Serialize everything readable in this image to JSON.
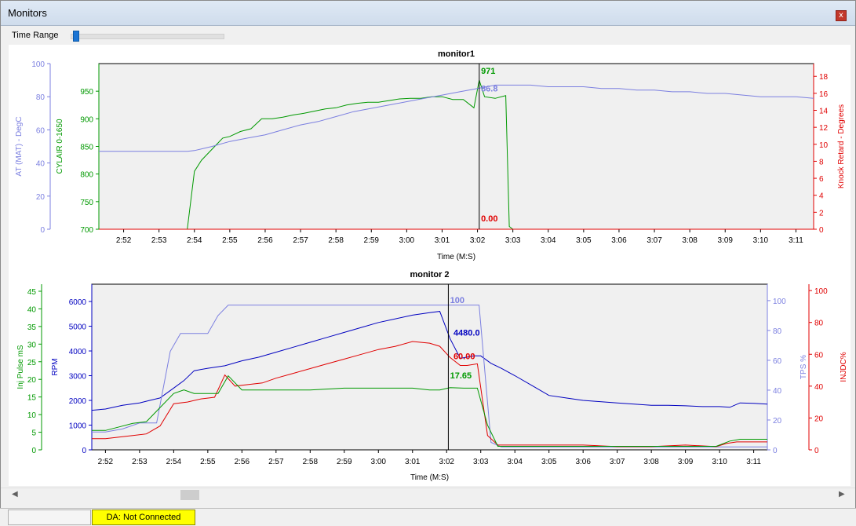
{
  "window": {
    "title": "Monitors",
    "close_label": "x"
  },
  "toolbar": {
    "time_range_label": "Time Range",
    "time_range_value": 0.02
  },
  "status": {
    "pane1": "",
    "da_status": "DA: Not Connected"
  },
  "colors": {
    "green": "#009900",
    "lightblue": "#7b7fe0",
    "red": "#e00000",
    "navy": "#0000c0",
    "darkred": "#cc0000"
  },
  "chart_data": [
    {
      "type": "line",
      "title": "monitor1",
      "xlabel": "Time (M:S)",
      "x_ticks": [
        "2:52",
        "2:53",
        "2:54",
        "2:55",
        "2:56",
        "2:57",
        "2:58",
        "2:59",
        "3:00",
        "3:01",
        "3:02",
        "3:03",
        "3:04",
        "3:05",
        "3:06",
        "3:07",
        "3:08",
        "3:09",
        "3:10",
        "3:11"
      ],
      "x_range": [
        171.3,
        191.5
      ],
      "cursor": {
        "x": 182.05
      },
      "axes": {
        "at": {
          "label": "AT (MAT) - DegC",
          "ylim": [
            0,
            100
          ],
          "ticks": [
            0,
            20,
            40,
            60,
            80,
            100
          ],
          "color": "#7b7fe0"
        },
        "cyl": {
          "label": "CYLAIR 0-1650",
          "ylim": [
            700,
            1000
          ],
          "ticks": [
            700,
            750,
            800,
            850,
            900,
            950
          ],
          "color": "#009900"
        },
        "knock": {
          "label": "Knock Retard - Degrees",
          "ylim": [
            0,
            19.5
          ],
          "ticks": [
            0,
            2,
            4,
            6,
            8,
            10,
            12,
            14,
            16,
            18
          ],
          "color": "#e00000"
        }
      },
      "series": [
        {
          "name": "CYLAIR 0-1650",
          "axis": "cyl",
          "color": "#009900",
          "x": [
            173.8,
            174.0,
            174.2,
            174.5,
            174.8,
            175.0,
            175.3,
            175.6,
            175.9,
            176.2,
            176.5,
            176.8,
            177.1,
            177.4,
            177.7,
            178.0,
            178.3,
            178.6,
            178.9,
            179.2,
            179.5,
            179.8,
            180.1,
            180.4,
            180.7,
            181.0,
            181.3,
            181.6,
            181.9,
            182.05,
            182.2,
            182.5,
            182.8,
            182.9,
            183.0
          ],
          "y": [
            700,
            805,
            825,
            845,
            865,
            868,
            877,
            882,
            900,
            900,
            903,
            907,
            910,
            914,
            918,
            920,
            925,
            928,
            930,
            930,
            933,
            936,
            937,
            937,
            940,
            940,
            935,
            935,
            920,
            970,
            940,
            937,
            942,
            705,
            700
          ],
          "label": "971",
          "label_x": 182.1
        },
        {
          "name": "AT (MAT) - DegC",
          "axis": "at",
          "color": "#7b7fe0",
          "x": [
            171.3,
            173.8,
            174.0,
            174.5,
            175.0,
            175.5,
            176.0,
            176.5,
            177.0,
            177.5,
            178.0,
            178.5,
            179.0,
            179.5,
            180.0,
            180.5,
            181.0,
            181.5,
            182.0,
            182.5,
            183.0,
            183.5,
            184.0,
            184.5,
            185.0,
            185.5,
            186.0,
            186.5,
            187.0,
            187.5,
            188.0,
            188.5,
            189.0,
            189.5,
            190.0,
            190.5,
            191.0,
            191.5
          ],
          "y": [
            47,
            47,
            47.5,
            50,
            53,
            55,
            57,
            60,
            63,
            65,
            68,
            71,
            73,
            75,
            77,
            79,
            81,
            83,
            85,
            87,
            87,
            87,
            86,
            86,
            86,
            85,
            85,
            84,
            84,
            83,
            83,
            82,
            82,
            81,
            80,
            80,
            80,
            79
          ],
          "label": "86.8",
          "label_x": 182.1
        },
        {
          "name": "Knock Retard - Degrees",
          "axis": "knock",
          "color": "#e00000",
          "x": [
            171.3,
            191.5
          ],
          "y": [
            0,
            0
          ],
          "label": "0.00",
          "label_x": 182.1
        }
      ]
    },
    {
      "type": "line",
      "title": "monitor 2",
      "xlabel": "Time (M:S)",
      "x_ticks": [
        "2:52",
        "2:53",
        "2:54",
        "2:55",
        "2:56",
        "2:57",
        "2:58",
        "2:59",
        "3:00",
        "3:01",
        "3:02",
        "3:03",
        "3:04",
        "3:05",
        "3:06",
        "3:07",
        "3:08",
        "3:09",
        "3:10",
        "3:11"
      ],
      "x_range": [
        171.6,
        191.4
      ],
      "cursor": {
        "x": 182.05
      },
      "axes": {
        "inj": {
          "label": "Inj Pulse mS",
          "ylim": [
            0,
            47
          ],
          "ticks": [
            0,
            5,
            10,
            15,
            20,
            25,
            30,
            35,
            40,
            45
          ],
          "color": "#009900"
        },
        "rpm": {
          "label": "RPM",
          "ylim": [
            0,
            6700
          ],
          "ticks": [
            0,
            1000,
            2000,
            3000,
            4000,
            5000,
            6000
          ],
          "color": "#0000c0"
        },
        "tps": {
          "label": "TPS %",
          "ylim": [
            0,
            111
          ],
          "ticks": [
            0,
            20,
            40,
            60,
            80,
            100
          ],
          "color": "#7b7fe0"
        },
        "injdc": {
          "label": "INJDC%",
          "ylim": [
            0,
            104
          ],
          "ticks": [
            0,
            20,
            40,
            60,
            80,
            100
          ],
          "color": "#e00000"
        }
      },
      "series": [
        {
          "name": "RPM",
          "axis": "rpm",
          "color": "#0000c0",
          "x": [
            171.6,
            172.0,
            172.5,
            173.0,
            173.3,
            173.6,
            174.0,
            174.3,
            174.6,
            175.0,
            175.5,
            176.0,
            176.5,
            177.0,
            177.5,
            178.0,
            178.5,
            179.0,
            179.5,
            180.0,
            180.5,
            181.0,
            181.5,
            181.8,
            182.1,
            182.4,
            182.6,
            182.8,
            183.0,
            183.3,
            183.6,
            184.0,
            184.5,
            185.0,
            185.5,
            186.0,
            186.5,
            187.0,
            187.5,
            188.0,
            188.5,
            189.0,
            189.5,
            190.0,
            190.3,
            190.6,
            191.0,
            191.4
          ],
          "y": [
            1600,
            1650,
            1800,
            1900,
            2000,
            2100,
            2500,
            2800,
            3200,
            3300,
            3400,
            3600,
            3750,
            3950,
            4150,
            4350,
            4550,
            4750,
            4950,
            5150,
            5300,
            5450,
            5550,
            5600,
            4500,
            3700,
            3750,
            3800,
            3800,
            3500,
            3300,
            3000,
            2600,
            2200,
            2100,
            2000,
            1950,
            1900,
            1850,
            1800,
            1800,
            1780,
            1750,
            1750,
            1720,
            1900,
            1880,
            1850
          ],
          "label": "4480.0",
          "label_x": 182.2
        },
        {
          "name": "TPS %",
          "axis": "tps",
          "color": "#7b7fe0",
          "x": [
            171.6,
            172.0,
            172.5,
            173.0,
            173.5,
            173.9,
            174.2,
            174.5,
            175.0,
            175.3,
            175.6,
            176.0,
            178.0,
            180.0,
            182.0,
            182.95,
            183.3,
            183.6,
            184.0,
            186.0,
            188.0,
            190.0,
            191.4
          ],
          "y": [
            12,
            12,
            14,
            18,
            18,
            66,
            78,
            78,
            78,
            90,
            97,
            97,
            97,
            97,
            97,
            97,
            5,
            2,
            2,
            2,
            2,
            2,
            2
          ],
          "label": "100",
          "label_x": 182.1
        },
        {
          "name": "INJDC%",
          "axis": "injdc",
          "color": "#e00000",
          "x": [
            171.6,
            172.0,
            172.4,
            172.8,
            173.2,
            173.6,
            174.0,
            174.4,
            174.8,
            175.2,
            175.5,
            175.8,
            176.2,
            176.6,
            177.0,
            177.5,
            178.0,
            178.5,
            179.0,
            179.5,
            180.0,
            180.5,
            181.0,
            181.5,
            181.8,
            182.1,
            182.4,
            182.6,
            182.9,
            183.2,
            183.5,
            184.0,
            185.0,
            186.0,
            187.0,
            188.0,
            189.0,
            189.9,
            190.2,
            190.5,
            191.0,
            191.4
          ],
          "y": [
            7,
            7,
            8,
            9,
            10,
            15,
            29,
            30,
            32,
            33,
            47,
            40,
            41,
            42,
            45,
            48,
            51,
            54,
            57,
            60,
            63,
            65,
            68,
            67,
            65,
            58,
            53,
            53,
            54,
            9,
            3,
            3,
            3,
            3,
            2,
            2,
            3,
            2,
            4,
            5,
            5,
            5
          ],
          "label": "60.00",
          "label_x": 182.2
        },
        {
          "name": "Inj Pulse mS",
          "axis": "inj",
          "color": "#009900",
          "x": [
            171.6,
            172.0,
            172.4,
            172.8,
            173.2,
            173.6,
            174.0,
            174.3,
            174.6,
            175.0,
            175.3,
            175.6,
            176.0,
            177.0,
            178.0,
            179.0,
            180.0,
            181.0,
            181.5,
            181.8,
            182.1,
            182.5,
            182.9,
            183.2,
            183.5,
            184.0,
            185.0,
            186.0,
            187.0,
            188.0,
            189.0,
            189.9,
            190.3,
            190.6,
            191.0,
            191.4
          ],
          "y": [
            5.5,
            5.5,
            6.5,
            7.5,
            8,
            12,
            16,
            17,
            16,
            16,
            16,
            21,
            17,
            17,
            17,
            17.5,
            17.5,
            17.5,
            17,
            17,
            17.65,
            17.5,
            17.5,
            7,
            1,
            1,
            1,
            1,
            1,
            1,
            1,
            1,
            2.5,
            3,
            3,
            3
          ],
          "label": "17.65",
          "label_x": 182.1
        }
      ]
    }
  ]
}
